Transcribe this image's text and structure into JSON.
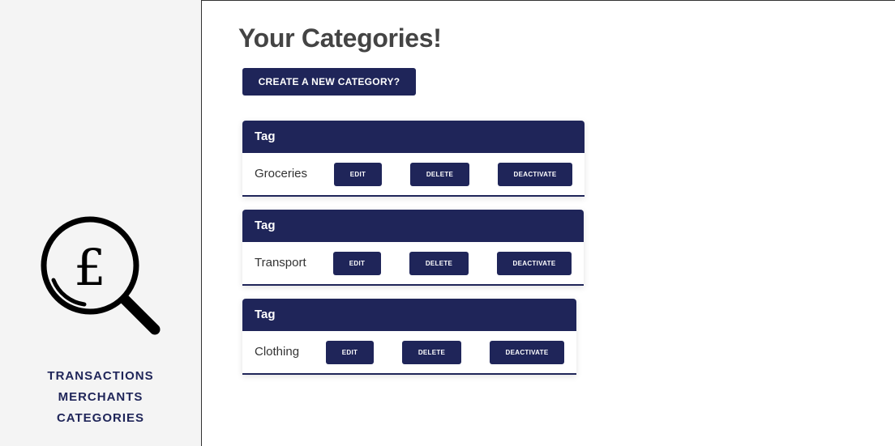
{
  "sidebar": {
    "logo_icon": "magnifying-glass-pound-icon",
    "logo_symbol": "£",
    "nav": [
      {
        "label": "TRANSACTIONS"
      },
      {
        "label": "MERCHANTS"
      },
      {
        "label": "CATEGORIES"
      }
    ]
  },
  "main": {
    "title": "Your Categories!",
    "create_button": "CREATE A NEW CATEGORY?",
    "categories": [
      {
        "header": "Tag",
        "name": "Groceries",
        "edit": "EDIT",
        "delete": "DELETE",
        "deactivate": "DEACTIVATE"
      },
      {
        "header": "Tag",
        "name": "Transport",
        "edit": "EDIT",
        "delete": "DELETE",
        "deactivate": "DEACTIVATE"
      },
      {
        "header": "Tag",
        "name": "Clothing",
        "edit": "EDIT",
        "delete": "DELETE",
        "deactivate": "DEACTIVATE"
      }
    ]
  },
  "colors": {
    "accent": "#1f2559",
    "sidebar_bg": "#f4f4f4",
    "title_text": "#444444"
  }
}
